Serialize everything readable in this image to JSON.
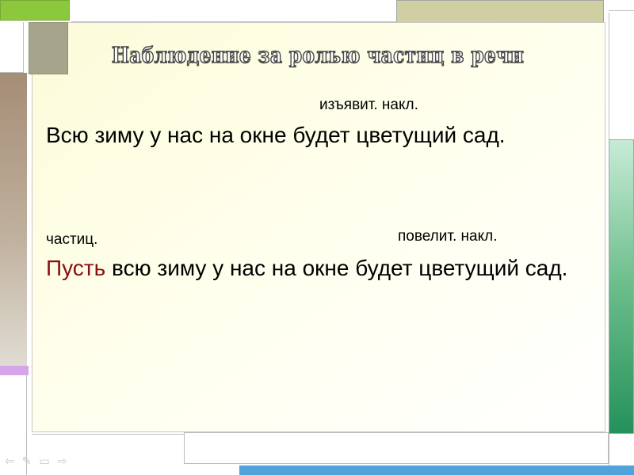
{
  "slide": {
    "title": "Наблюдение за ролью частиц в речи",
    "note_top": "изъявит. накл.",
    "sentence1": "Всю зиму у нас на окне будет цветущий сад.",
    "note_particle": "частиц.",
    "note_imperative": "повелит. накл.",
    "sentence2_particle": "Пусть",
    "sentence2_rest": " всю зиму у нас на окне будет цветущий сад.",
    "colors": {
      "particle": "#8b0f0f",
      "accent_green": "#8bc83b",
      "accent_blue": "#4fa3d8",
      "accent_lavender": "#d6a4e8"
    }
  },
  "nav": {
    "icons": [
      "back-arrow-icon",
      "pen-icon",
      "menu-icon",
      "forward-arrow-icon"
    ]
  }
}
